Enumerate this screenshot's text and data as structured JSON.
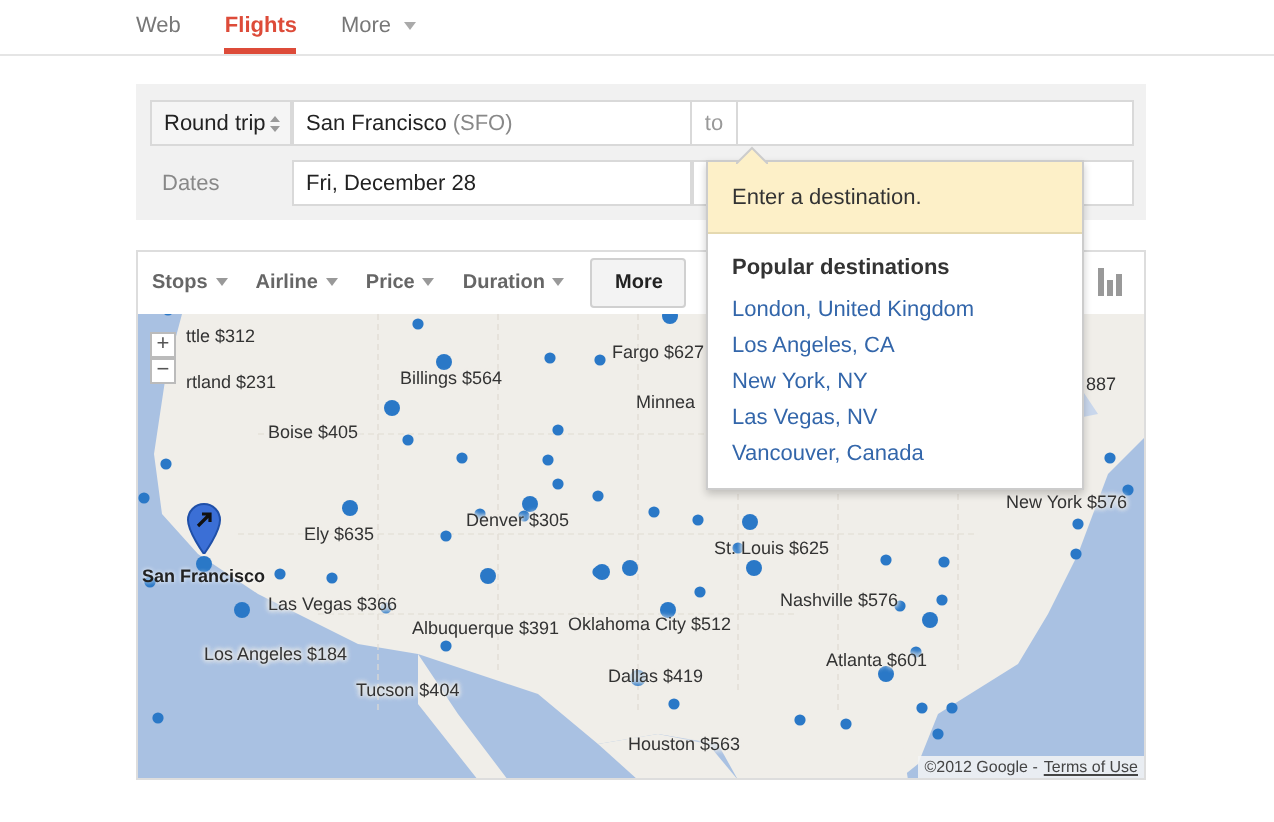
{
  "nav": [
    {
      "label": "Web",
      "selected": false,
      "dropdown": false
    },
    {
      "label": "Flights",
      "selected": true,
      "dropdown": false
    },
    {
      "label": "More",
      "selected": false,
      "dropdown": true
    }
  ],
  "search": {
    "trip_type": "Round trip",
    "origin": {
      "value": "San Francisco",
      "code": "(SFO)"
    },
    "to_label": "to",
    "dates_label": "Dates",
    "depart_date": "Fri, December 28"
  },
  "filters": [
    {
      "label": "Stops",
      "kind": "dropdown"
    },
    {
      "label": "Airline",
      "kind": "dropdown"
    },
    {
      "label": "Price",
      "kind": "dropdown"
    },
    {
      "label": "Duration",
      "kind": "dropdown"
    },
    {
      "label": "More",
      "kind": "button"
    }
  ],
  "popup": {
    "message": "Enter a destination.",
    "heading": "Popular destinations",
    "destinations": [
      "London, United Kingdom",
      "Los Angeles, CA",
      "New York, NY",
      "Las Vegas, NV",
      "Vancouver, Canada"
    ]
  },
  "map": {
    "zoom_in": "+",
    "zoom_out": "−",
    "origin_label": "San Francisco",
    "copyright": "©2012 Google -",
    "terms": "Terms of Use",
    "cities": [
      "ttle $312",
      "rtland $231",
      "Billings $564",
      "Fargo $627",
      "Minnea",
      "Boise $405",
      "Ely $635",
      "Denver $305",
      "St. Louis $625",
      "887",
      "New York $576",
      "Las Vegas $366",
      "Albuquerque $391",
      "Oklahoma City $512",
      "Nashville $576",
      "Los Angeles $184",
      "Dallas $419",
      "Atlanta $601",
      "Tucson $404",
      "Houston $563"
    ]
  }
}
